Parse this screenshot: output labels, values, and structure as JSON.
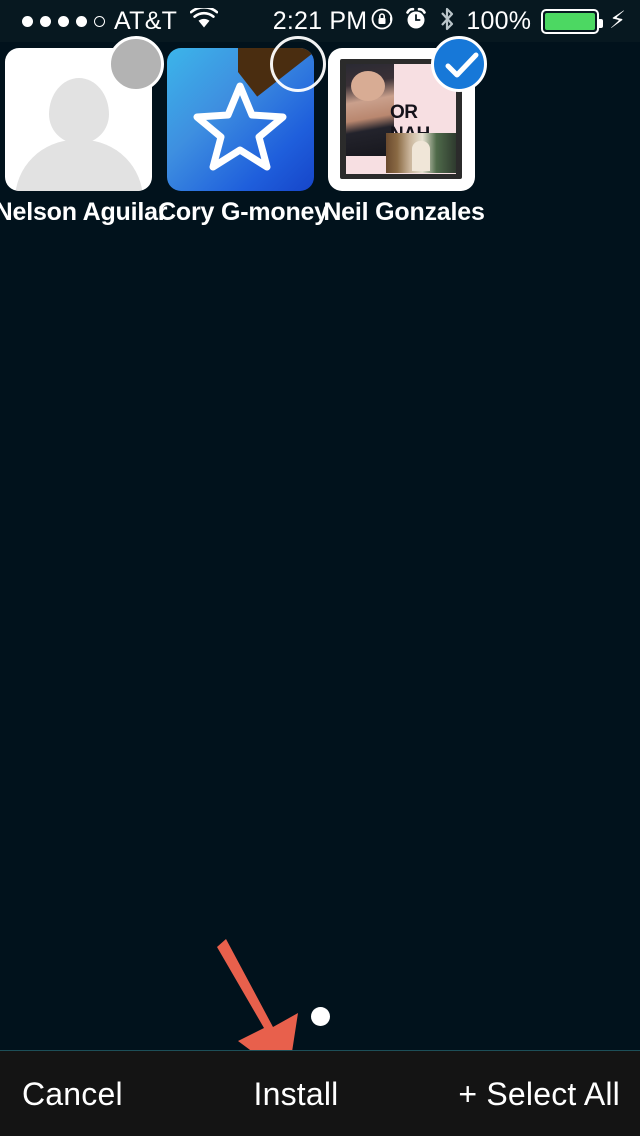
{
  "status_bar": {
    "signal_dots_filled": 4,
    "signal_dots_total": 5,
    "carrier": "AT&T",
    "wifi_icon": "wifi-icon",
    "time": "2:21 PM",
    "rotation_lock_icon": "rotation-lock-icon",
    "alarm_icon": "alarm-clock-icon",
    "bluetooth_icon": "bluetooth-icon",
    "battery_percent": "100%",
    "battery_level": 100,
    "charging_icon": "lightning-bolt-icon",
    "battery_color": "#4cd862",
    "background": "#071820"
  },
  "thumbnails": [
    {
      "name": "Nelson Aguilar",
      "avatar_type": "blank-contact-silhouette",
      "selected": false,
      "badge": "gray-circle"
    },
    {
      "name": "Cory G-money",
      "avatar_type": "blue-gradient-star",
      "selected": false,
      "badge": "empty-circle"
    },
    {
      "name": "Neil Gonzales",
      "avatar_type": "or-nah-meme-photo",
      "meme_text": "OR NAH",
      "selected": true,
      "badge": "blue-checkmark"
    }
  ],
  "annotation": {
    "arrow_color": "#e8604c",
    "arrow_points_to": "Install"
  },
  "page_indicator": {
    "dots": 1,
    "active_index": 0,
    "color": "#ffffff"
  },
  "toolbar": {
    "cancel_label": "Cancel",
    "install_label": "Install",
    "select_all_label": "+ Select All",
    "background": "#141414"
  },
  "theme": {
    "main_background": "#01121c",
    "accent_blue": "#1778d8",
    "text_color": "#ffffff"
  }
}
